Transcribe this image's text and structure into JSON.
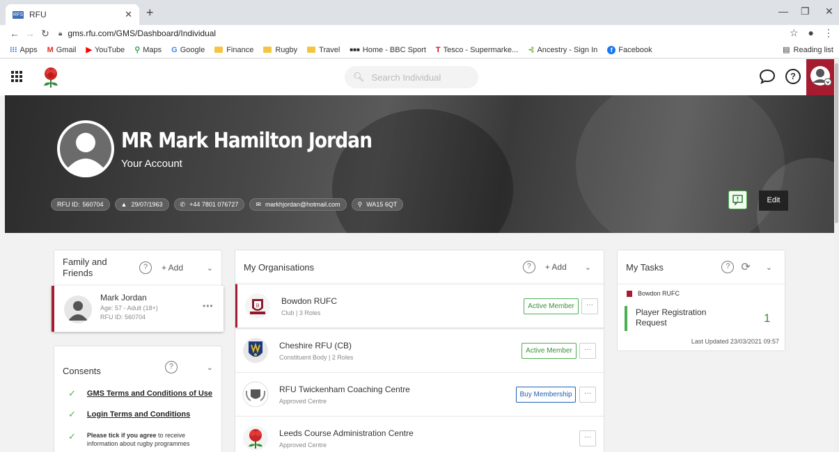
{
  "browser": {
    "tab_title": "RFU",
    "tab_favicon": "RFS",
    "url": "gms.rfu.com/GMS/Dashboard/Individual",
    "bookmarks": [
      {
        "label": "Apps",
        "icon": "apps-icon"
      },
      {
        "label": "Gmail",
        "icon": "gmail-icon"
      },
      {
        "label": "YouTube",
        "icon": "youtube-icon"
      },
      {
        "label": "Maps",
        "icon": "maps-icon"
      },
      {
        "label": "Google",
        "icon": "google-icon"
      },
      {
        "label": "Finance",
        "icon": "folder-icon"
      },
      {
        "label": "Rugby",
        "icon": "folder-icon"
      },
      {
        "label": "Travel",
        "icon": "folder-icon"
      },
      {
        "label": "Home - BBC Sport",
        "icon": "bbc-icon"
      },
      {
        "label": "Tesco - Supermarke...",
        "icon": "tesco-icon"
      },
      {
        "label": "Ancestry - Sign In",
        "icon": "ancestry-icon"
      },
      {
        "label": "Facebook",
        "icon": "facebook-icon"
      }
    ],
    "reading_list": "Reading list"
  },
  "header": {
    "search_placeholder": "Search Individual"
  },
  "profile": {
    "name": "MR Mark Hamilton Jordan",
    "subtitle": "Your Account",
    "rfu_id_label": "RFU ID:",
    "rfu_id": "560704",
    "dob": "29/07/1963",
    "phone": "+44 7801 076727",
    "email": "markhjordan@hotmail.com",
    "postcode": "WA15 6QT",
    "edit_label": "Edit"
  },
  "family": {
    "title": "Family and Friends",
    "add_label": "+ Add",
    "member": {
      "name": "Mark Jordan",
      "age": "Age: 57 - Adult (18+)",
      "rfu_id": "RFU ID: 560704"
    }
  },
  "consents": {
    "title": "Consents",
    "items": [
      {
        "text": "GMS Terms and Conditions of Use"
      },
      {
        "text": "Login Terms and Conditions"
      }
    ],
    "note_bold": "Please tick if you agree",
    "note_rest": " to receive information about rugby programmes"
  },
  "organisations": {
    "title": "My Organisations",
    "add_label": "+ Add",
    "items": [
      {
        "name": "Bowdon RUFC",
        "type": "Club | 3 Roles",
        "button": "Active Member",
        "status": "active"
      },
      {
        "name": "Cheshire RFU (CB)",
        "type": "Constituent Body | 2 Roles",
        "button": "Active Member",
        "status": "active"
      },
      {
        "name": "RFU Twickenham Coaching Centre",
        "type": "Approved Centre",
        "button": "Buy Membership",
        "status": "buy"
      },
      {
        "name": "Leeds Course Administration Centre",
        "type": "Approved Centre",
        "button": "",
        "status": "none"
      }
    ]
  },
  "tasks": {
    "title": "My Tasks",
    "org": "Bowdon RUFC",
    "task_label": "Player Registration Request",
    "count": "1",
    "last_updated": "Last Updated 23/03/2021 09:57"
  },
  "colors": {
    "brand_red": "#a51c30",
    "active_green": "#4caf50",
    "buy_blue": "#1e5fb3"
  }
}
